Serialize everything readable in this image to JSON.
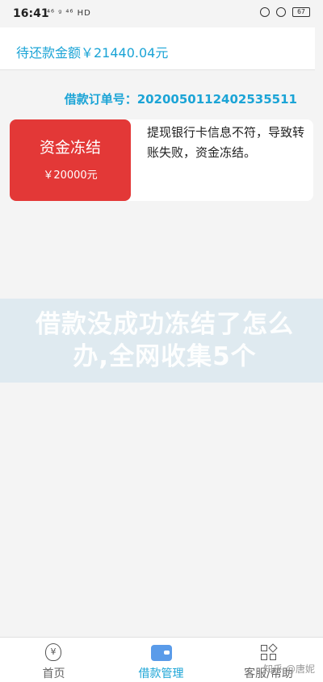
{
  "status_bar": {
    "time": "16:41",
    "network": "⁴⁶ ᵍ ⁴⁶ HD",
    "battery": "67"
  },
  "header": {
    "pending_amount": "待还款金额￥21440.04元"
  },
  "order": {
    "label": "借款订单号：2020050112402535511"
  },
  "frozen_card": {
    "title": "资金冻结",
    "amount": "￥20000元",
    "reason": "提现银行卡信息不符，导致转账失败，资金冻结。"
  },
  "banner": {
    "text": "借款没成功冻结了怎么办,全网收集5个"
  },
  "bottom_nav": {
    "home": "首页",
    "loan_manage": "借款管理",
    "help": "客服/帮助",
    "active_color": "#1ba4d6"
  },
  "watermark": "知乎 @唐妮",
  "icons": {
    "home": "money-bag-icon",
    "loan": "wallet-icon",
    "help": "grid-icon"
  }
}
